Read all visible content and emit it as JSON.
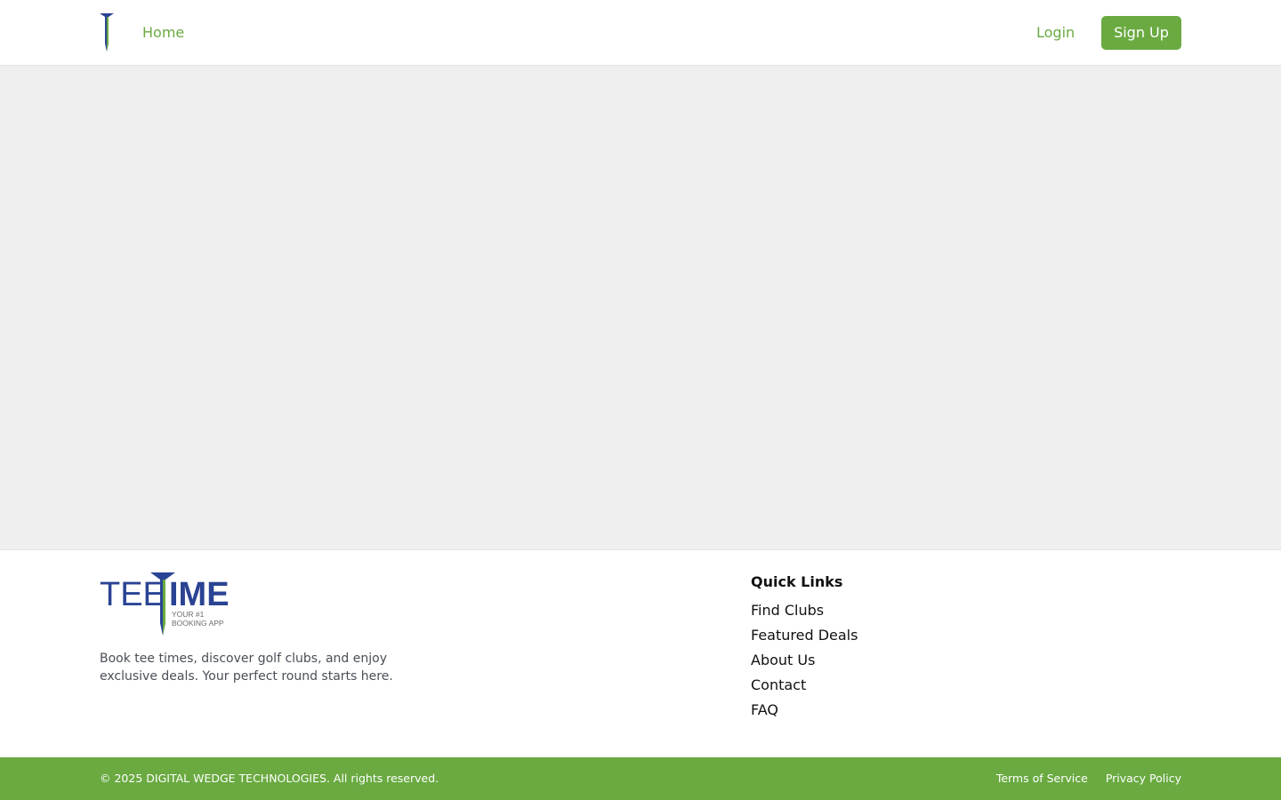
{
  "header": {
    "logo_icon": "tee-icon",
    "nav_home": "Home",
    "login": "Login",
    "signup": "Sign Up"
  },
  "colors": {
    "brand_green": "#6aaa41",
    "brand_navy": "#2a4393",
    "main_bg": "#efefef"
  },
  "footer": {
    "logo": {
      "word_left": "TEE",
      "word_right": "IME",
      "tagline_line1": "YOUR #1",
      "tagline_line2": "BOOKING APP"
    },
    "description": "Book tee times, discover golf clubs, and enjoy exclusive deals. Your perfect round starts here.",
    "quick_links_title": "Quick Links",
    "quick_links": [
      "Find Clubs",
      "Featured Deals",
      "About Us",
      "Contact",
      "FAQ"
    ]
  },
  "bottom_bar": {
    "copyright": "© 2025 DIGITAL WEDGE TECHNOLOGIES. All rights reserved.",
    "terms": "Terms of Service",
    "privacy": "Privacy Policy"
  }
}
